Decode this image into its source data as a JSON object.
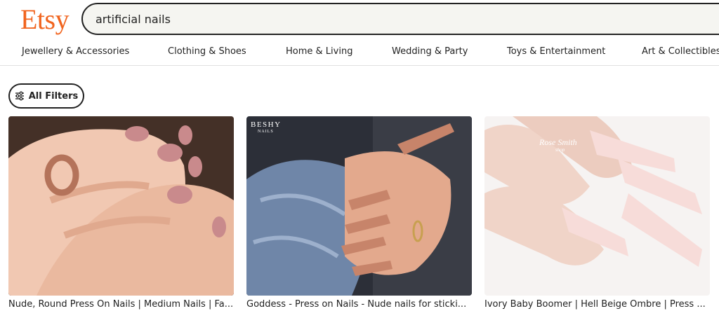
{
  "header": {
    "logo": "Etsy",
    "search_value": "artificial nails"
  },
  "categories": [
    "Jewellery & Accessories",
    "Clothing & Shoes",
    "Home & Living",
    "Wedding & Party",
    "Toys & Entertainment",
    "Art & Collectibles"
  ],
  "filters": {
    "label": "All Filters",
    "icon": "sliders-icon"
  },
  "listings": [
    {
      "title": "Nude, Round Press On Nails | Medium Nails | Fa..."
    },
    {
      "title": "Goddess - Press on Nails - Nude nails for sticki...",
      "brand": "BESHY",
      "brand_sub": "NAILS"
    },
    {
      "title": "Ivory Baby Boomer | Hell Beige Ombre | Press ...",
      "brand": "Rose Smith",
      "brand_sub": "shop"
    }
  ],
  "colors": {
    "brand": "#f1641e",
    "search_bg": "#f5f5f1"
  }
}
